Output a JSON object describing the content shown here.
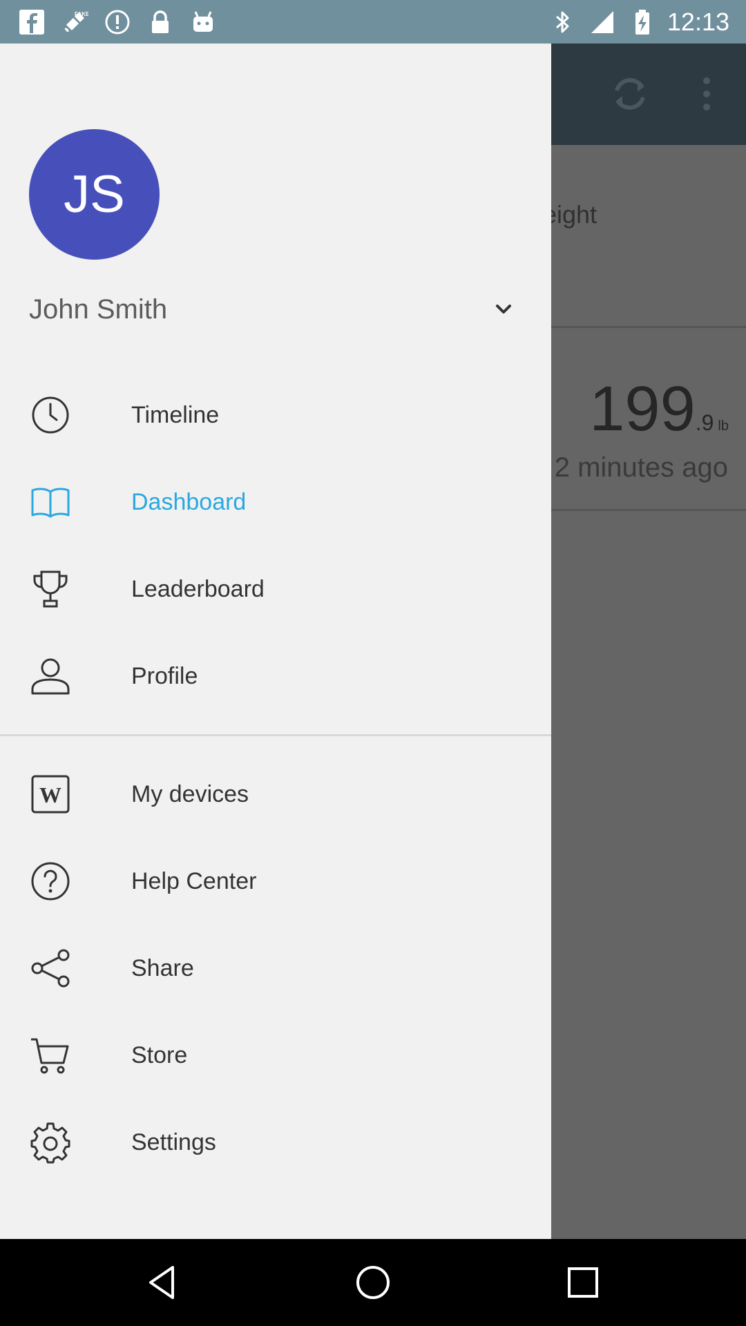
{
  "status_bar": {
    "time": "12:13",
    "left_icons": [
      "facebook-icon",
      "fake-gps-icon",
      "info-alert-icon",
      "lock-icon",
      "android-icon"
    ],
    "right_icons": [
      "bluetooth-icon",
      "signal-icon",
      "battery-icon"
    ]
  },
  "background": {
    "label_partial": "weight",
    "weight_int": "199",
    "weight_dec": ".9",
    "weight_unit": "lb",
    "time_ago_partial": "2 minutes ago"
  },
  "drawer": {
    "avatar_initials": "JS",
    "account_name": "John Smith",
    "items": [
      {
        "label": "Timeline",
        "icon": "clock-icon",
        "active": false
      },
      {
        "label": "Dashboard",
        "icon": "book-icon",
        "active": true
      },
      {
        "label": "Leaderboard",
        "icon": "trophy-icon",
        "active": false
      },
      {
        "label": "Profile",
        "icon": "person-icon",
        "active": false
      }
    ],
    "secondary_items": [
      {
        "label": "My devices",
        "icon": "device-w-icon"
      },
      {
        "label": "Help Center",
        "icon": "help-circle-icon"
      },
      {
        "label": "Share",
        "icon": "share-icon"
      },
      {
        "label": "Store",
        "icon": "cart-icon"
      },
      {
        "label": "Settings",
        "icon": "gear-icon"
      }
    ]
  },
  "colors": {
    "status_bar": "#71909e",
    "avatar": "#4750ba",
    "accent": "#2aa8e0",
    "drawer_bg": "#f1f1f1",
    "scrim": "#656565"
  }
}
